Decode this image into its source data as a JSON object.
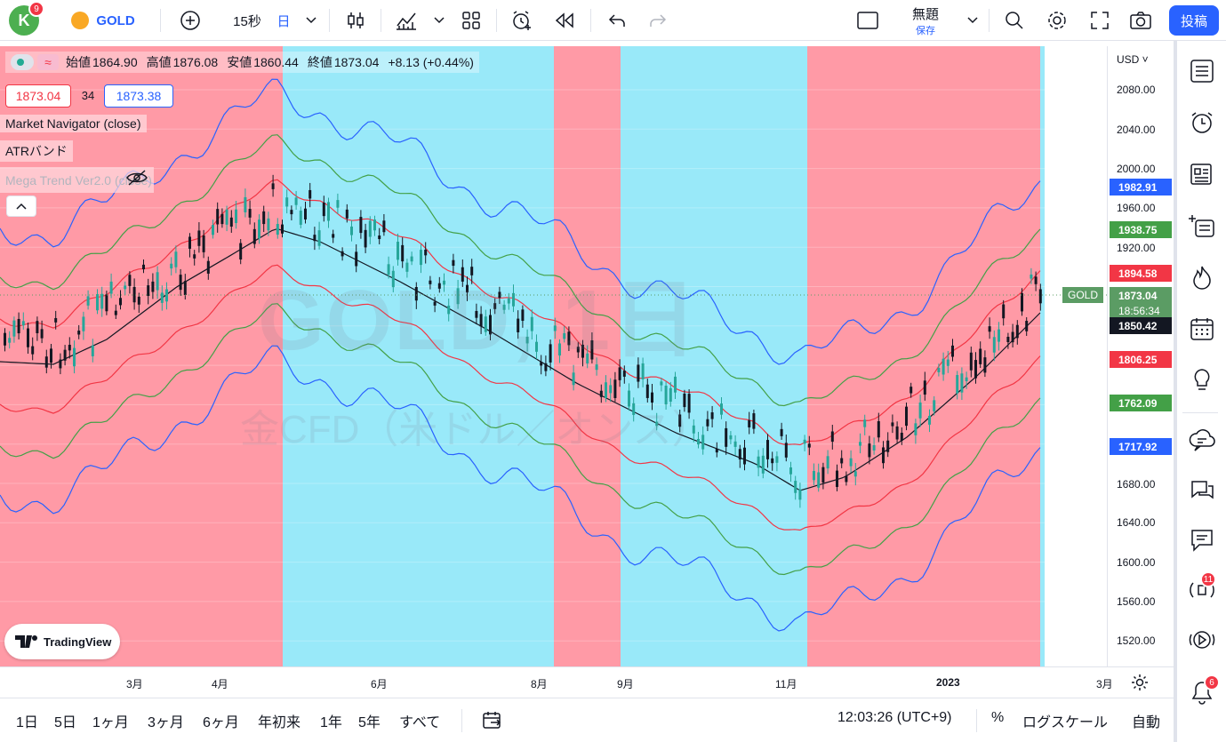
{
  "top": {
    "avatar_letter": "K",
    "avatar_badge": "9",
    "symbol": "GOLD",
    "interval": "15秒",
    "interval_unit": "日",
    "layout_name": "無題",
    "layout_saved": "保存",
    "publish": "投稿"
  },
  "legend": {
    "open_label": "始値",
    "open": "1864.90",
    "high_label": "高値",
    "high": "1876.08",
    "low_label": "安値",
    "low": "1860.44",
    "close_label": "終値",
    "close": "1873.04",
    "change": "+8.13 (+0.44%)",
    "bid": "1873.04",
    "spread": "34",
    "ask": "1873.38",
    "ind1": "Market Navigator (close)",
    "ind2": "ATRバンド",
    "ind3": "Mega Trend Ver2.0 (close)"
  },
  "watermark": {
    "line1": "GOLD, 1日",
    "line2": "金CFD（米ドル／オンス）"
  },
  "price_axis": {
    "currency": "USD",
    "labels": [
      "2080.00",
      "2040.00",
      "2000.00",
      "1960.00",
      "1920.00",
      "1640.00",
      "1600.00",
      "1560.00",
      "1520.00",
      "1680.00"
    ],
    "tags": [
      {
        "value": "1982.91",
        "color": "#2962ff"
      },
      {
        "value": "1938.75",
        "color": "#43a047"
      },
      {
        "value": "1894.58",
        "color": "#f23645"
      },
      {
        "value": "1873.04",
        "color": "#5b9c64"
      },
      {
        "value": "18:56:34",
        "color": "#5b9c64"
      },
      {
        "value": "1850.42",
        "color": "#131722"
      },
      {
        "value": "1806.25",
        "color": "#f23645"
      },
      {
        "value": "1762.09",
        "color": "#43a047"
      },
      {
        "value": "1717.92",
        "color": "#2962ff"
      }
    ],
    "symbol_tag": "GOLD"
  },
  "time_axis": [
    "3月",
    "4月",
    "6月",
    "8月",
    "9月",
    "11月",
    "2023",
    "3月"
  ],
  "bottom": {
    "ranges": [
      "1日",
      "5日",
      "1ヶ月",
      "3ヶ月",
      "6ヶ月",
      "年初来",
      "1年",
      "5年",
      "すべて"
    ],
    "clock": "12:03:26 (UTC+9)",
    "percent": "%",
    "log": "ログスケール",
    "auto": "自動"
  },
  "logo": "TradingView",
  "right_badges": {
    "alerts": "11",
    "notifications": "6"
  },
  "colors": {
    "red_zone": "#ff9aa6",
    "cyan_zone": "#99e9f9",
    "band_blue": "#2962ff",
    "band_green": "#43a047",
    "band_red": "#f23645",
    "band_black": "#131722"
  }
}
